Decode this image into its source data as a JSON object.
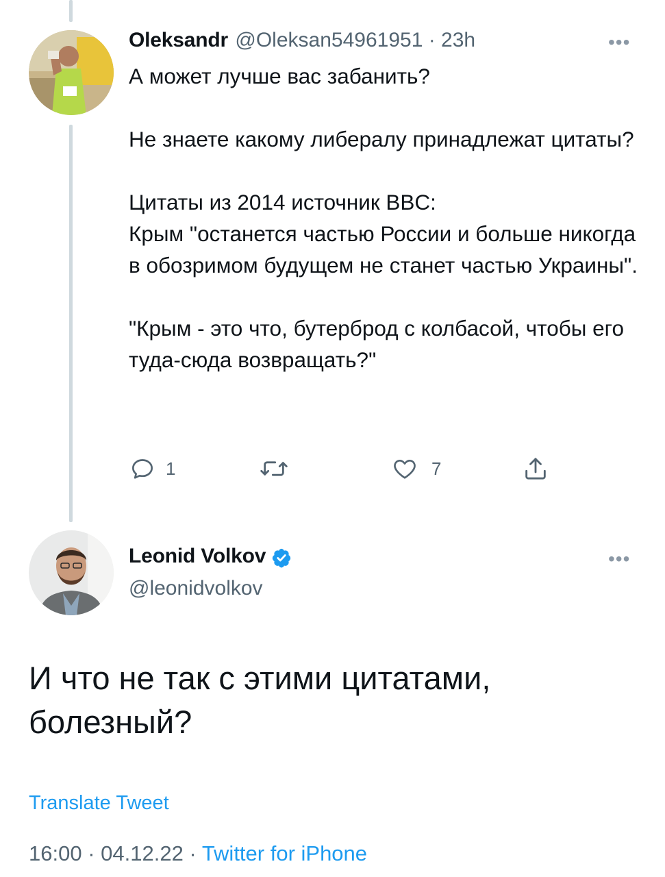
{
  "reply_tweet": {
    "author_name": "Oleksandr",
    "author_handle": "@Oleksan54961951",
    "separator": " · ",
    "time_ago": "23h",
    "more_label": "•••",
    "text": "А может лучше вас забанить?\n\nНе знаете какому либералу принадлежат цитаты?\n\nЦитаты из 2014 источник BBC:\nКрым \"останется частью России и больше никогда в обозримом будущем не станет частью Украины\".\n\n\"Крым - это что, бутерброд с колбасой, чтобы его туда-сюда возвращать?\"",
    "reply_count": "1",
    "like_count": "7",
    "icons": {
      "reply": "comment-icon",
      "retweet": "retweet-icon",
      "like": "heart-icon",
      "share": "share-icon"
    }
  },
  "main_tweet": {
    "author_name": "Leonid Volkov",
    "author_handle": "@leonidvolkov",
    "verified_icon": "verified-badge-icon",
    "more_label": "•••",
    "text": "И что не так с этими цитатами, болезный?",
    "translate_label": "Translate Tweet",
    "time": "16:00",
    "date": "04.12.22",
    "meta_separator": " · ",
    "source": "Twitter for iPhone"
  },
  "colors": {
    "accent": "#1d9bf0",
    "secondary_text": "#536471",
    "thread_line": "#cfd9de"
  }
}
